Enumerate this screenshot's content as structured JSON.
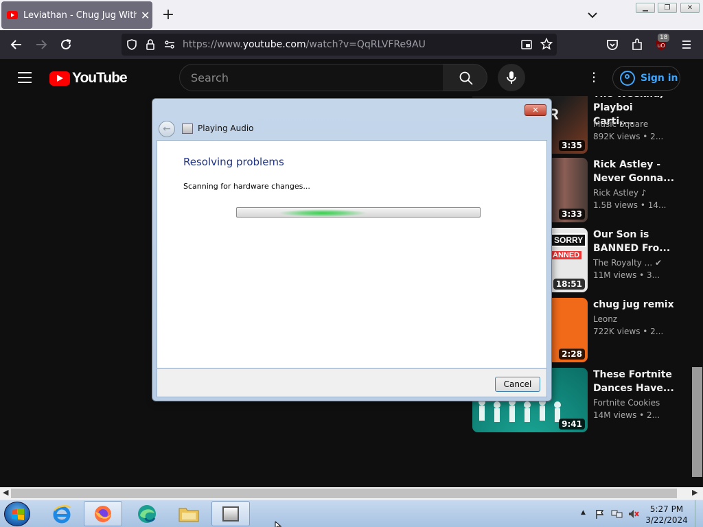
{
  "browser": {
    "tab_title": "Leviathan - Chug Jug With You",
    "url_prefix": "https://www.",
    "url_domain": "youtube.com",
    "url_path": "/watch?v=QqRLVFRe9AU",
    "extension_badge": "18"
  },
  "youtube": {
    "logo_text": "YouTube",
    "search_placeholder": "Search",
    "sign_in": "Sign in",
    "videos": [
      {
        "title": "The Weeknd, Playboi Carti,...",
        "channel": "Music Square",
        "meta": "892K views • 2...",
        "duration": "3:35",
        "thumb_color": "#5a2c1e"
      },
      {
        "title": "Rick Astley - Never Gonna...",
        "channel": "Rick Astley ♪",
        "meta": "1.5B views • 14...",
        "duration": "3:33",
        "thumb_color": "#7b4d48"
      },
      {
        "title": "Our Son is BANNED Fro...",
        "channel": "The Royalty ... ✔",
        "meta": "11M views • 3...",
        "duration": "18:51",
        "thumb_color": "#d8d8d8"
      },
      {
        "title": "chug jug remix",
        "channel": "Leonz",
        "meta": "722K views • 2...",
        "duration": "2:28",
        "thumb_color": "#f06a1a"
      },
      {
        "title": "These Fortnite Dances Have...",
        "channel": "Fortnite Cookies",
        "meta": "14M views • 2...",
        "duration": "9:41",
        "thumb_color": "#10847a"
      }
    ]
  },
  "dialog": {
    "title": "Playing Audio",
    "heading": "Resolving problems",
    "status": "Scanning for hardware changes...",
    "cancel": "Cancel",
    "close": "✕"
  },
  "taskbar": {
    "time": "5:27 PM",
    "date": "3/22/2024"
  }
}
